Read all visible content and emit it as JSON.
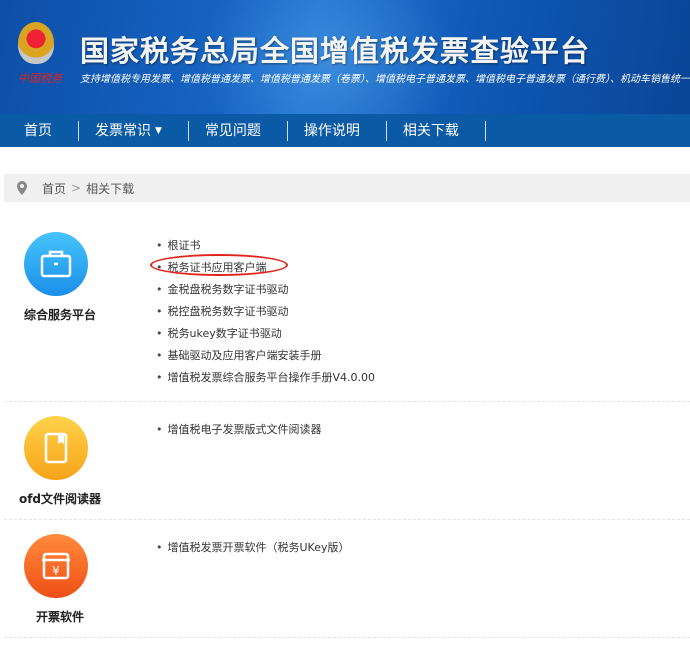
{
  "header": {
    "title": "国家税务总局全国增值税发票查验平台",
    "subtitle": "支持增值税专用发票、增值税普通发票、增值税普通发票（卷票）、增值税电子普通发票、增值税电子普通发票（通行费）、机动车销售统一发票",
    "seal_text": "中国税务"
  },
  "nav": {
    "items": [
      {
        "label": "首页"
      },
      {
        "label": "发票常识"
      },
      {
        "label": "常见问题"
      },
      {
        "label": "操作说明"
      },
      {
        "label": "相关下载"
      }
    ]
  },
  "breadcrumb": {
    "home": "首页",
    "sep": ">",
    "current": "相关下载"
  },
  "sections": [
    {
      "label": "综合服务平台",
      "color": "#2aa3ee",
      "links": [
        "根证书",
        "税务证书应用客户端",
        "金税盘税务数字证书驱动",
        "税控盘税务数字证书驱动",
        "税务ukey数字证书驱动",
        "基础驱动及应用客户端安装手册",
        "增值税发票综合服务平台操作手册V4.0.00"
      ]
    },
    {
      "label": "ofd文件阅读器",
      "color": "#f6b322",
      "links": [
        "增值税电子发票版式文件阅读器"
      ]
    },
    {
      "label": "开票软件",
      "color": "#f2651d",
      "links": [
        "增值税发票开票软件（税务UKey版）"
      ]
    }
  ],
  "annotation": {
    "color": "#e0231b",
    "highlighted": "税务证书应用客户端"
  }
}
